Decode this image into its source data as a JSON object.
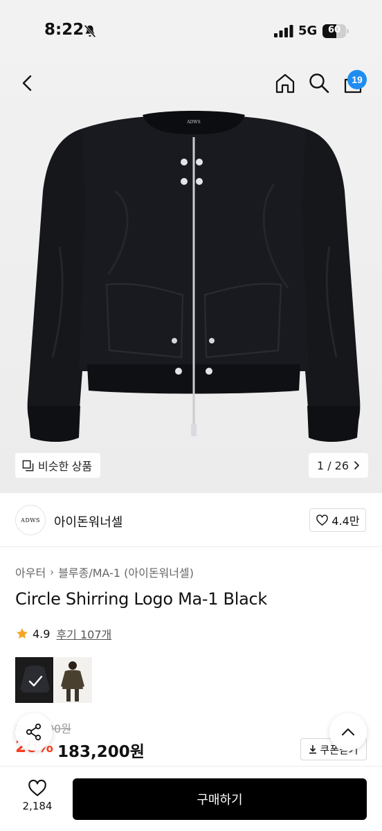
{
  "status_bar": {
    "time": "8:22",
    "network": "5G",
    "battery": "60",
    "battery_level": 0.6
  },
  "header": {
    "cart_count": "19"
  },
  "gallery": {
    "similar_label": "비슷한 상품",
    "page_counter": "1 / 26",
    "brand_mark": "ADWS"
  },
  "brand": {
    "logo_text": "ADWS",
    "name": "아이돈워너셀",
    "likes": "4.4만"
  },
  "product": {
    "breadcrumb": [
      "아우터",
      "블루종/MA-1 (아이돈워너셀)"
    ],
    "title": "Circle Shirring Logo Ma-1 Black",
    "rating": "4.9",
    "reviews": "후기 107개",
    "original_price": "229,000원",
    "discount": "20%",
    "price": "183,200원",
    "coupon_label": "쿠폰받기"
  },
  "bottom_bar": {
    "wish_count": "2,184",
    "buy_label": "구매하기"
  },
  "colors": {
    "accent": "#1f8df0",
    "discount": "#ff3d1f",
    "star": "#f5a623",
    "buy": "#000000"
  },
  "icons": [
    "bell-slash-icon",
    "signal-icon",
    "back-icon",
    "home-icon",
    "search-icon",
    "bag-icon",
    "similar-icon",
    "chevron-right-icon",
    "heart-icon",
    "star-icon",
    "share-icon",
    "download-icon",
    "chevron-up-icon"
  ]
}
